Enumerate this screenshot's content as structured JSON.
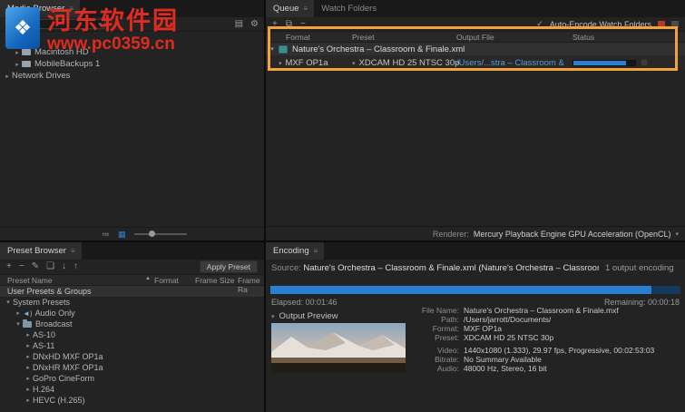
{
  "colors": {
    "accent_blue": "#2a7fd0",
    "link_blue": "#5b9bd5",
    "highlight_orange": "#f2a33c",
    "watermark_red": "#e02b20"
  },
  "watermark": {
    "title": "河东软件园",
    "url": "www.pc0359.cn"
  },
  "media_browser": {
    "tab": "Media Browser",
    "tree": [
      {
        "label": "Macintosh HD"
      },
      {
        "label": "MobileBackups 1"
      },
      {
        "label": "Network Drives"
      }
    ]
  },
  "queue": {
    "tab_queue": "Queue",
    "tab_watch": "Watch Folders",
    "auto_encode": "Auto-Encode Watch Folders",
    "columns": {
      "format": "Format",
      "preset": "Preset",
      "output": "Output File",
      "status": "Status"
    },
    "job": {
      "source": "Nature's Orchestra – Classroom & Finale.xml",
      "format": "MXF OP1a",
      "preset": "XDCAM HD 25 NTSC 30p",
      "output_file": "/Users/...stra – Classroom & Finale.mxf",
      "progress_pct": 85
    },
    "renderer_label": "Renderer:",
    "renderer_value": "Mercury Playback Engine GPU Acceleration (OpenCL)"
  },
  "preset_browser": {
    "tab": "Preset Browser",
    "apply_button": "Apply Preset",
    "columns": {
      "name": "Preset Name",
      "format": "Format",
      "frame_size": "Frame Size",
      "frame_rate": "Frame Ra"
    },
    "tree": [
      {
        "label": "User Presets & Groups"
      },
      {
        "label": "System Presets"
      },
      {
        "label": "Audio Only"
      },
      {
        "label": "Broadcast"
      },
      {
        "label": "AS-10"
      },
      {
        "label": "AS-11"
      },
      {
        "label": "DNxHD MXF OP1a"
      },
      {
        "label": "DNxHR MXF OP1a"
      },
      {
        "label": "GoPro CineForm"
      },
      {
        "label": "H.264"
      },
      {
        "label": "HEVC (H.265)"
      }
    ]
  },
  "encoding": {
    "tab": "Encoding",
    "source_label": "Source:",
    "source_value": "Nature's Orchestra – Classroom & Finale.xml (Nature's Orchestra – Classroom & Finale.prproj)",
    "outputs_note": "1 output encoding",
    "progress_pct": 93,
    "elapsed": "Elapsed: 00:01:46",
    "remaining": "Remaining: 00:00:18",
    "preview_label": "Output Preview",
    "details": [
      {
        "key": "File Name:",
        "value": "Nature's Orchestra – Classroom & Finale.mxf"
      },
      {
        "key": "Path:",
        "value": "/Users/jarrott/Documents/"
      },
      {
        "key": "Format:",
        "value": "MXF OP1a"
      },
      {
        "key": "Preset:",
        "value": "XDCAM HD 25 NTSC 30p"
      },
      {
        "key": "Video:",
        "value": "1440x1080 (1.333), 29.97 fps, Progressive, 00:02:53:03"
      },
      {
        "key": "Bitrate:",
        "value": "No Summary Available"
      },
      {
        "key": "Audio:",
        "value": "48000 Hz, Stereo, 16 bit"
      }
    ]
  }
}
